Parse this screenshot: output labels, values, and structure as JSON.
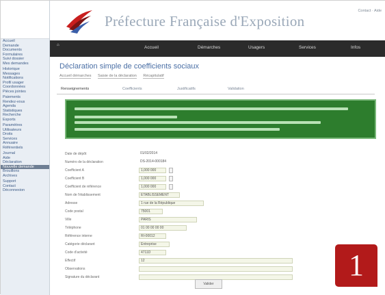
{
  "header": {
    "site_title": "Préfecture Française d'Exposition",
    "top_links": "Contact · Aide"
  },
  "navbar": {
    "home": "⌂",
    "items": [
      "Accueil",
      "Démarches",
      "Usagers",
      "Services",
      "Infos"
    ]
  },
  "sidebar": {
    "items": [
      "Accueil",
      "Demande",
      "Documents",
      "Formulaires",
      "Suivi dossier",
      "Mes demandes",
      "Historique",
      "Messages",
      "Notifications",
      "Profil usager",
      "Coordonnées",
      "Pièces jointes",
      "Paiements",
      "Rendez-vous",
      "Agenda",
      "Statistiques",
      "Recherche",
      "Exports",
      "Paramètres",
      "Utilisateurs",
      "Droits",
      "Services",
      "Annuaire",
      "Référentiels",
      "Journal",
      "Aide",
      "Déclaration",
      "Nouvelle demande",
      "Brouillons",
      "Archives",
      "Support",
      "Contact",
      "Déconnexion"
    ],
    "active_index": 27
  },
  "content": {
    "title": "Déclaration simple de coefficients sociaux",
    "breadcrumbs": [
      "Accueil démarches",
      "Saisie de la déclaration",
      "Récapitulatif"
    ],
    "tabs": [
      "Renseignements",
      "Coefficients",
      "Justificatifs",
      "Validation"
    ],
    "active_tab": 0
  },
  "form": {
    "rows": [
      {
        "label": "Date de dépôt",
        "value": "01/02/2014"
      },
      {
        "label": "Numéro de la déclaration",
        "value": "DS-2014-000184"
      },
      {
        "label": "Coefficient A",
        "value": "1,000 000"
      },
      {
        "label": "Coefficient B",
        "value": "1,000 000"
      },
      {
        "label": "Coefficient de référence",
        "value": "1,000 000"
      },
      {
        "label": "Nom de l'établissement",
        "value": "ETABLISSEMENT"
      },
      {
        "label": "Adresse",
        "value": "1 rue de la République"
      },
      {
        "label": "Code postal",
        "value": "75001"
      },
      {
        "label": "Ville",
        "value": "PARIS"
      },
      {
        "label": "Téléphone",
        "value": "01 00 00 00 00"
      },
      {
        "label": "Référence interne",
        "value": "RI-00012"
      },
      {
        "label": "Catégorie déclarant",
        "value": "Entreprise"
      },
      {
        "label": "Code d'activité",
        "value": "4711D"
      },
      {
        "label": "Effectif",
        "value": "12"
      },
      {
        "label": "Observations",
        "value": ""
      },
      {
        "label": "Signature du déclarant",
        "value": ""
      }
    ],
    "submit_label": "Valider"
  },
  "badge": {
    "step": "1"
  },
  "colors": {
    "nav": "#2b2b2b",
    "alert": "#2d7d2d",
    "badge": "#b21a1a",
    "link": "#4a6fa5"
  }
}
